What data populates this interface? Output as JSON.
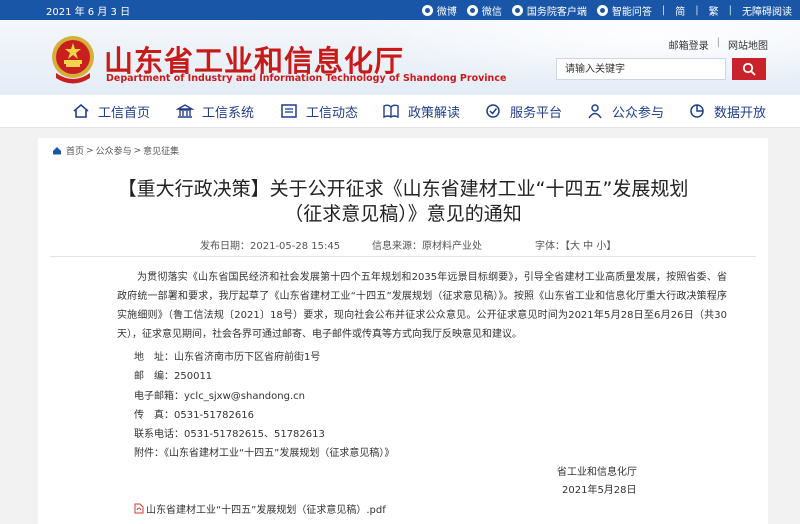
{
  "topbar": {
    "date": "2021 年 6 月 3 日",
    "links": [
      "微博",
      "微信",
      "国务院客户端",
      "智能问答"
    ],
    "lang": "简",
    "lang2": "繁",
    "accessibility": "无障碍阅读"
  },
  "header": {
    "title": "山东省工业和信息化厅",
    "subtitle": "Department of Industry and Information Technology of Shandong Province",
    "mail_login": "邮箱登录",
    "site_map": "网站地图",
    "search_placeholder": "请输入关键字"
  },
  "nav": {
    "items": [
      {
        "label": "工信首页",
        "icon": "home-icon"
      },
      {
        "label": "工信系统",
        "icon": "building-icon"
      },
      {
        "label": "工信动态",
        "icon": "news-icon"
      },
      {
        "label": "政策解读",
        "icon": "policy-icon"
      },
      {
        "label": "服务平台",
        "icon": "service-icon"
      },
      {
        "label": "公众参与",
        "icon": "people-icon"
      },
      {
        "label": "数据开放",
        "icon": "data-icon"
      }
    ]
  },
  "breadcrumb": [
    "首页",
    "公众参与",
    "意见征集"
  ],
  "article": {
    "title_line1": "【重大行政决策】关于公开征求《山东省建材工业“十四五”发展规划",
    "title_line2": "（征求意见稿）》意见的通知",
    "publish_time": "发布日期：2021-05-28 15:45",
    "source": "信息来源：原材料产业处",
    "font_size": "字体：【大 中 小】",
    "paragraph": "为贯彻落实《山东省国民经济和社会发展第十四个五年规划和2035年远景目标纲要》，引导全省建材工业高质量发展，按照省委、省政府统一部署和要求，我厅起草了《山东省建材工业“十四五”发展规划（征求意见稿）》。按照《山东省工业和信息化厅重大行政决策程序实施细则》（鲁工信法规〔2021〕18号）要求，现向社会公布并征求公众意见。公开征求意见时间为2021年5月28日至6月26日（共30天），征求意见期间，社会各界可通过邮寄、电子邮件或传真等方式向我厅反映意见和建议。",
    "address": "地　址：山东省济南市历下区省府前街1号",
    "postcode": "邮　编：250011",
    "email": "电子邮箱：yclc_sjxw@shandong.cn",
    "fax": "传　真：0531-51782616",
    "phone": "联系电话：0531-51782615、51782613",
    "attachment_note": "附件：《山东省建材工业“十四五”发展规划（征求意见稿）》",
    "sign_org": "省工业和信息化厅",
    "sign_date": "2021年5月28日",
    "attachment_file": "山东省建材工业“十四五”发展规划（征求意见稿）.pdf"
  },
  "colors": {
    "topbar": "#1a56a8",
    "title_red": "#c91a1a",
    "nav_text": "#1f3f88",
    "search_button": "#c9222a"
  }
}
